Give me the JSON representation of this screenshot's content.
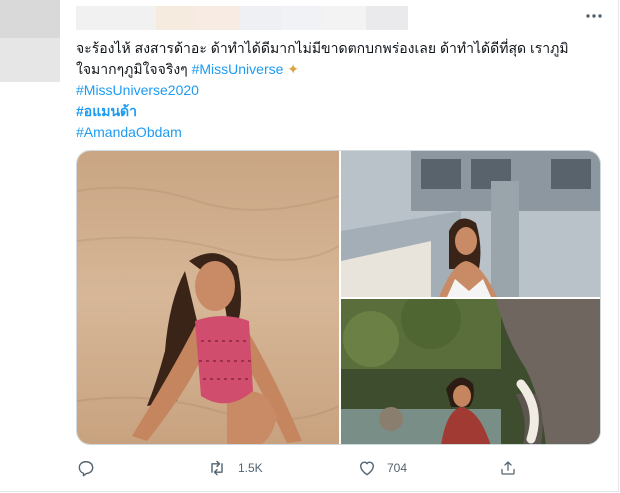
{
  "tweet": {
    "line1_text": "จะร้องไห้ สงสารด้าอะ ด้าทำได้ดีมากไม่มีขาดตกบกพร่องเลย ด้าทำได้ดีที่สุด เราภูมิ",
    "line2_text": "ใจมากๆภูมิใจจริงๆ ",
    "line2_tag": "#MissUniverse",
    "line2_spark": "✦",
    "tag_miss_universe_2020": "#MissUniverse2020",
    "tag_thai": "#อแมนด้า",
    "tag_amanda": "#AmandaObdam"
  },
  "actions": {
    "reply_count": "",
    "retweet_count": "1.5K",
    "like_count": "704"
  },
  "icons": {
    "more": "more-icon",
    "reply": "reply-icon",
    "retweet": "retweet-icon",
    "like": "heart-icon",
    "share": "share-icon"
  },
  "colors": {
    "link": "#1d9bf0",
    "muted": "#536471"
  }
}
